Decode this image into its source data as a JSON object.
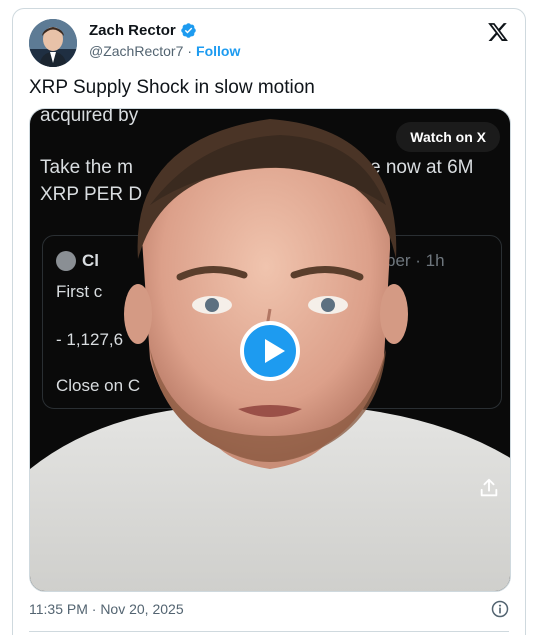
{
  "author": {
    "name": "Zach Rector",
    "handle": "@ZachRector7",
    "separator": "·",
    "follow_label": "Follow",
    "verified_color": "#1d9bf0"
  },
  "tweet": {
    "text": "XRP Supply Shock in slow motion"
  },
  "media": {
    "watch_label": "Watch on X",
    "background_text": {
      "line1": "acquired by",
      "line2_a": "Take the m",
      "line2_b": "e now at 6M",
      "line3": "XRP PER D",
      "quote_name": "Cl",
      "quote_meta": "ber · 1h",
      "quote_line1": "First c",
      "quote_line2": "- 1,127,6",
      "quote_line3": "Close on C"
    }
  },
  "footer": {
    "timestamp": "11:35 PM · Nov 20, 2025"
  },
  "colors": {
    "accent": "#1d9bf0",
    "text": "#0f1419",
    "muted": "#536471",
    "border": "#cfd9de"
  }
}
